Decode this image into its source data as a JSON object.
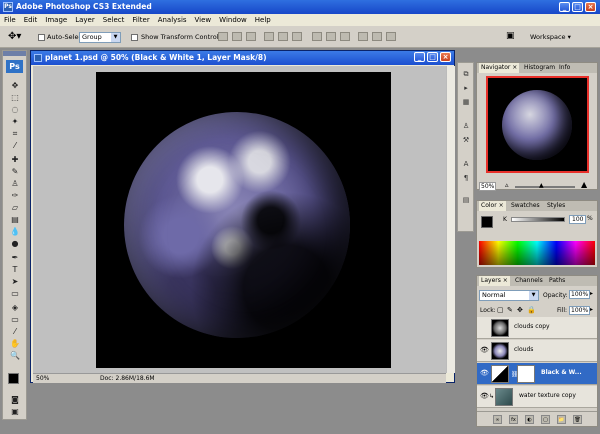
{
  "app": {
    "title": "Adobe Photoshop CS3 Extended",
    "ps_badge": "Ps",
    "ps_small": "Ps"
  },
  "window_buttons": {
    "minimize": "_",
    "maximize": "□",
    "close": "×"
  },
  "menu": [
    "File",
    "Edit",
    "Image",
    "Layer",
    "Select",
    "Filter",
    "Analysis",
    "View",
    "Window",
    "Help"
  ],
  "options_bar": {
    "auto_select_label": "Auto-Select:",
    "auto_select_value": "Group",
    "show_transform_label": "Show Transform Controls",
    "workspace_label": "Workspace ▾"
  },
  "document": {
    "title": "planet 1.psd @ 50% (Black & White 1, Layer Mask/8)",
    "zoom": "50%",
    "doc_info": "Doc: 2.86M/18.6M"
  },
  "navigator": {
    "tabs": [
      "Navigator ×",
      "Histogram",
      "Info"
    ],
    "zoom": "50%"
  },
  "color_panel": {
    "tabs": [
      "Color ×",
      "Swatches",
      "Styles"
    ],
    "channel": "K",
    "value": "100",
    "unit": "%"
  },
  "layers_panel": {
    "tabs": [
      "Layers ×",
      "Channels",
      "Paths"
    ],
    "blend_mode": "Normal",
    "opacity_label": "Opacity:",
    "opacity_value": "100%",
    "lock_label": "Lock:",
    "fill_label": "Fill:",
    "fill_value": "100%",
    "layers": [
      {
        "name": "clouds copy",
        "visible": false,
        "selected": false
      },
      {
        "name": "clouds",
        "visible": true,
        "selected": false
      },
      {
        "name": "Black & W...",
        "visible": true,
        "selected": true
      },
      {
        "name": "water texture copy",
        "visible": true,
        "selected": false
      }
    ]
  },
  "icons": {
    "move_tool": "move-tool-icon",
    "eye": "👁",
    "bottom_icons": [
      "∞",
      "fx",
      "◐",
      "▢",
      "📁",
      "🗑"
    ]
  },
  "colors": {
    "title_blue": "#1747c8",
    "selection_blue": "#316ac5",
    "nav_frame_red": "#e8302a"
  }
}
